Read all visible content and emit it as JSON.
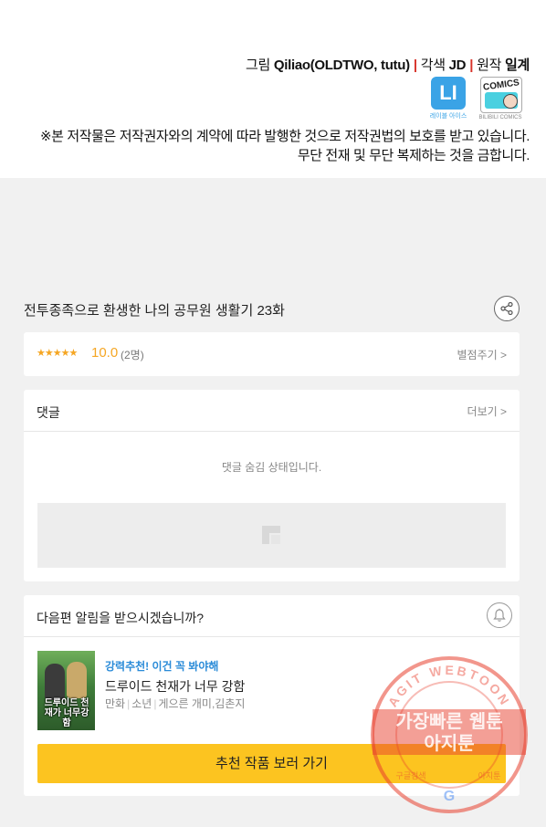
{
  "credits": {
    "art_label": "그림",
    "art_name": "Qiliao(OLDTWO, tutu)",
    "adapt_label": "각색",
    "adapt_name": "JD",
    "original_label": "원작",
    "original_name": "일계",
    "separator": "|",
    "logo_li_text": "LI",
    "logo_li_caption": "레이블 아이스",
    "logo_comics_text": "COMICS",
    "logo_comics_caption": "BILIBILI COMICS",
    "notice_line1": "※본 저작물은 저작권자와의 계약에 따라 발행한 것으로 저작권법의 보호를 받고 있습니다.",
    "notice_line2": "무단 전재 및 무단 복제하는 것을 금합니다."
  },
  "episode": {
    "title": "전투종족으로 환생한 나의 공무원 생활기 23화",
    "share_icon": "share-icon"
  },
  "rating": {
    "stars": "★★★★★",
    "score": "10.0",
    "count": "(2명)",
    "rate_link": "별점주기 >"
  },
  "comments": {
    "title": "댓글",
    "more_link": "더보기 >",
    "hidden_text": "댓글 숨김 상태입니다."
  },
  "notify": {
    "question": "다음편 알림을 받으시겠습니까?",
    "bell_icon": "bell-icon",
    "recommend_tag": "강력추천! 이건 꼭 봐야해",
    "recommend_title": "드루이드 천재가 너무 강함",
    "thumb_title": "드루이드 천재가 너무강함",
    "meta": [
      "만화",
      "소년",
      "게으른 개미,김촌지"
    ],
    "button_label": "추천 작품 보러 가기"
  },
  "watermark": {
    "ring_text": "AGIT WEBTOON",
    "line1": "가장빠른 웹툰",
    "line2": "아지툰",
    "bottom_left": "구글검색",
    "bottom_right": "아지툰",
    "bottom_mark": "G"
  },
  "colors": {
    "accent_yellow": "#fcc420",
    "star_orange": "#f5a623",
    "link_blue": "#2a8bd8",
    "separator_red": "#d8322a",
    "watermark_red": "#e8402e"
  }
}
